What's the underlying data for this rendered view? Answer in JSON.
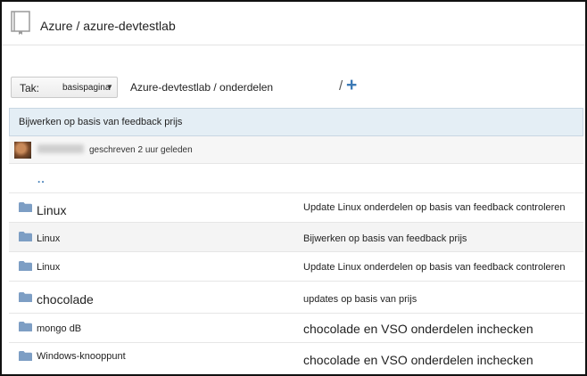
{
  "header": {
    "icon": "repository-book-icon",
    "title": "Azure / azure-devtestlab"
  },
  "toolbar": {
    "branch_prefix": "Tak:",
    "branch_name": "basispagina",
    "caret": "▼",
    "path": "Azure-devtestlab / onderdelen",
    "slash": "/",
    "add_label": "+"
  },
  "commit": {
    "message": "Bijwerken op basis van feedback prijs",
    "author_avatar": "avatar-photo",
    "author_name_redacted": true,
    "time": "geschreven 2 uur geleden"
  },
  "parent_link": "..",
  "files": [
    {
      "name": "Linux",
      "commit": "Update Linux onderdelen op basis van feedback controleren"
    },
    {
      "name": "Linux",
      "commit": "Bijwerken op basis van feedback prijs"
    },
    {
      "name": "Linux",
      "commit": "Update Linux onderdelen op basis van feedback controleren"
    },
    {
      "name": "chocolade",
      "commit": "updates op basis van prijs"
    },
    {
      "name": "mongo dB",
      "commit": "chocolade en VSO onderdelen inchecken"
    },
    {
      "name": "Windows-knooppunt",
      "commit": "chocolade en VSO onderdelen inchecken"
    }
  ],
  "colors": {
    "accent": "#3b79b5",
    "folder": "#7d9ec4",
    "banner_bg": "#e4eef5"
  }
}
